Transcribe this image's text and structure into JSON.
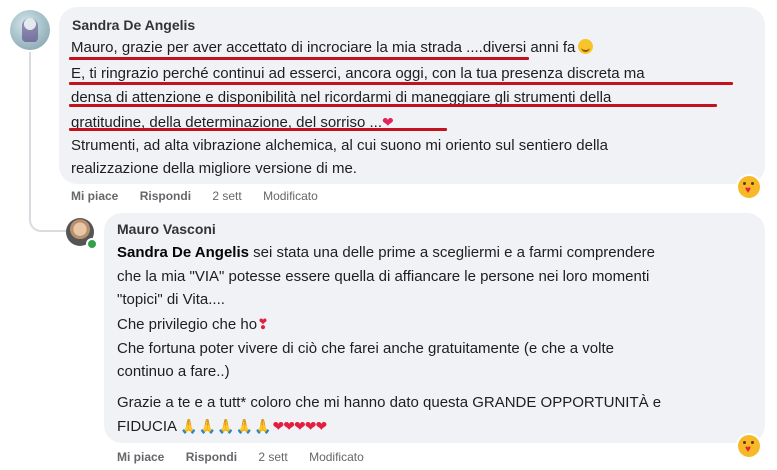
{
  "comment1": {
    "author": "Sandra De Angelis",
    "lines": [
      "Mauro, grazie per aver accettato di incrociare la mia strada ....diversi anni fa",
      "E, ti ringrazio perché continui ad esserci, ancora oggi, con la tua presenza discreta ma",
      "densa di attenzione e disponibilità nel ricordarmi di maneggiare gli strumenti della",
      "gratitudine, della determinazione, del sorriso ...",
      "Strumenti, ad alta vibrazione alchemica, al cui suono mi oriento sul sentiero della",
      "realizzazione della migliore versione di me."
    ],
    "like": "Mi piace",
    "reply": "Rispondi",
    "time": "2 sett",
    "edited": "Modificato"
  },
  "comment2": {
    "author": "Mauro Vasconi",
    "tag": "Sandra De Angelis",
    "lines": [
      " sei stata una delle prime a scegliermi e a farmi comprendere",
      "che la mia \"VIA\" potesse essere quella di affiancare le persone nei loro momenti",
      "\"topici\" di Vita....",
      "Che privilegio che ho",
      "Che fortuna poter vivere di ciò che farei anche gratuitamente (e che a volte",
      "continuo a fare..)",
      "Grazie a te e a tutt* coloro che mi hanno dato questa GRANDE OPPORTUNITÀ e",
      "FIDUCIA"
    ],
    "like": "Mi piace",
    "reply": "Rispondi",
    "time": "2 sett",
    "edited": "Modificato"
  },
  "icons": {
    "smile": "smiling-face-emoji",
    "heart": "heart-emoji",
    "pray": "folded-hands-emoji",
    "reaction": "care-reaction"
  },
  "colors": {
    "bubble": "#f0f2f5",
    "underline": "#c0131d",
    "online": "#31a24c"
  }
}
